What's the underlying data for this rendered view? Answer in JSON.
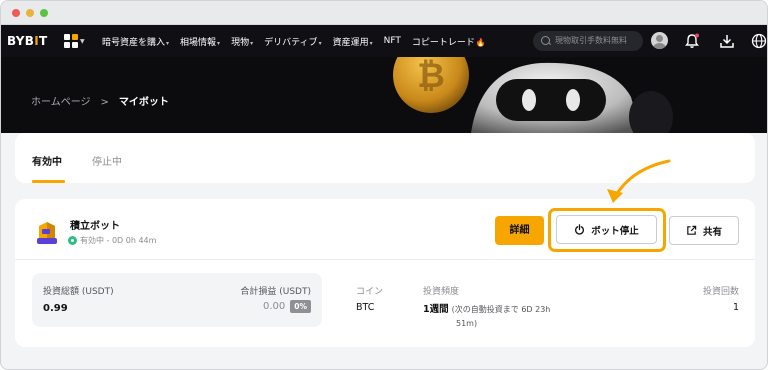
{
  "nav": {
    "logo_main": "BYB",
    "logo_accent": "I",
    "logo_tail": "T",
    "menu": [
      {
        "label": "暗号資産を購入",
        "caret": "▾"
      },
      {
        "label": "相場情報",
        "caret": "▾"
      },
      {
        "label": "現物",
        "caret": "▾"
      },
      {
        "label": "デリバティブ",
        "caret": "▾"
      },
      {
        "label": "資産運用",
        "caret": "▾"
      },
      {
        "label": "NFT",
        "caret": ""
      },
      {
        "label": "コピートレード",
        "caret": "🔥"
      }
    ],
    "search_placeholder": "現物取引手数料無料",
    "icons": [
      "avatar",
      "bell-icon",
      "download-icon",
      "globe-icon"
    ]
  },
  "breadcrumb": {
    "home": "ホームページ",
    "separator": ">",
    "current": "マイボット"
  },
  "tabs": {
    "active": "有効中",
    "inactive": "停止中"
  },
  "bot": {
    "name": "積立ボット",
    "status": "有効中 - 0D 0h 44m",
    "buttons": {
      "detail": "詳細",
      "stop": "ボット停止",
      "share": "共有"
    },
    "summary": {
      "invest_label": "投資総額 (USDT)",
      "invest_value": "0.99",
      "pnl_label": "合計損益 (USDT)",
      "pnl_value": "0.00",
      "pnl_pct": "0%"
    },
    "coin_label": "コイン",
    "coin_value": "BTC",
    "freq_label": "投資頻度",
    "freq_value": "1週間",
    "freq_note_line1": "(次の自動投資まで 6D 23h",
    "freq_note_line2": "51m)",
    "count_label": "投資回数",
    "count_value": "1"
  },
  "colors": {
    "accent": "#f7a600",
    "nav_bg": "#101014",
    "status_green": "#2ebd85"
  }
}
